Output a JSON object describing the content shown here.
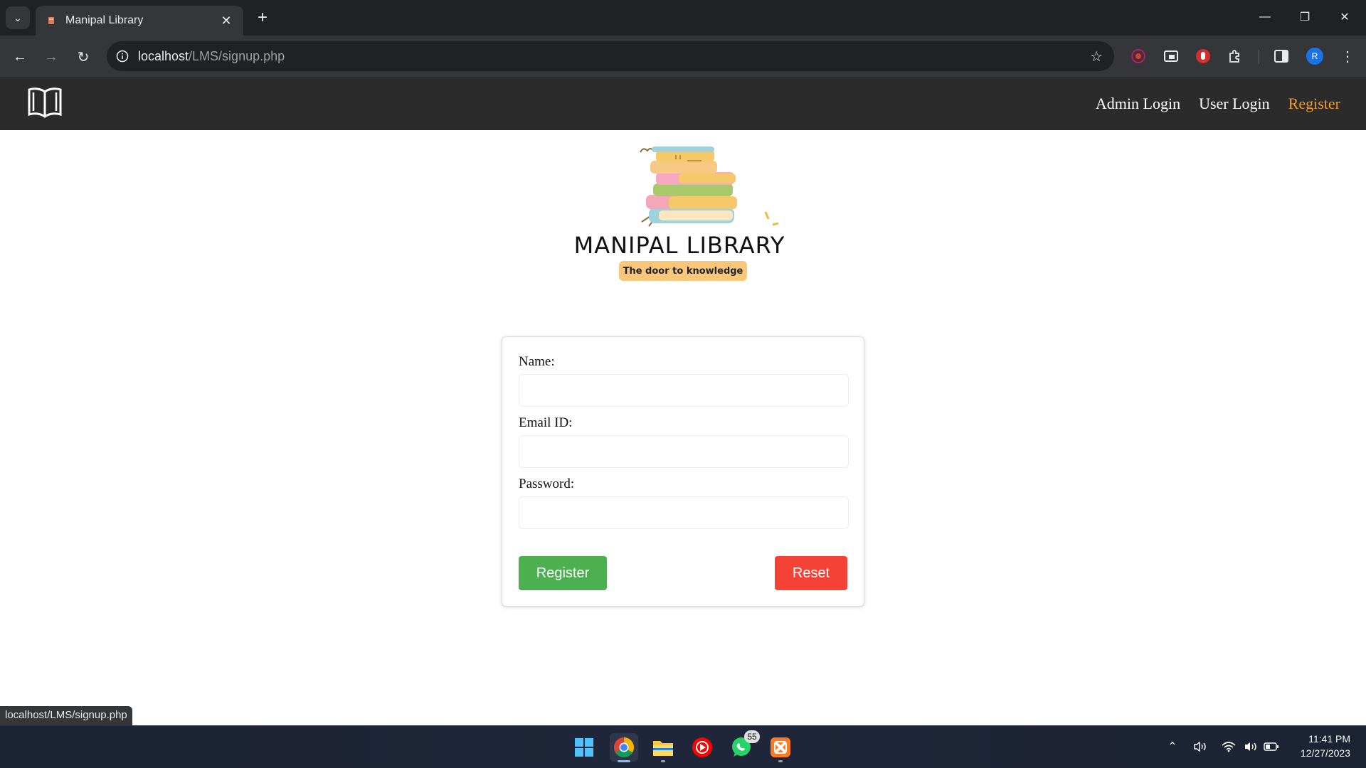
{
  "browser": {
    "tab_title": "Manipal Library",
    "url_host": "localhost",
    "url_path": "/LMS/signup.php",
    "status_url": "localhost/LMS/signup.php",
    "profile_initial": "R"
  },
  "nav": {
    "links": [
      {
        "label": "Admin Login"
      },
      {
        "label": "User Login"
      },
      {
        "label": "Register"
      }
    ],
    "active_color": "#f59a23"
  },
  "brand": {
    "title": "MANIPAL LIBRARY",
    "tagline": "The door to knowledge"
  },
  "form": {
    "name_label": "Name:",
    "email_label": "Email ID:",
    "password_label": "Password:",
    "name_value": "",
    "email_value": "",
    "password_value": "",
    "register_label": "Register",
    "reset_label": "Reset",
    "register_color": "#4caf50",
    "reset_color": "#f44336"
  },
  "taskbar": {
    "apps": [
      "windows-start",
      "chrome",
      "file-explorer",
      "youtube-music",
      "whatsapp",
      "xampp"
    ],
    "whatsapp_badge": "55",
    "time": "11:41 PM",
    "date": "12/27/2023"
  }
}
